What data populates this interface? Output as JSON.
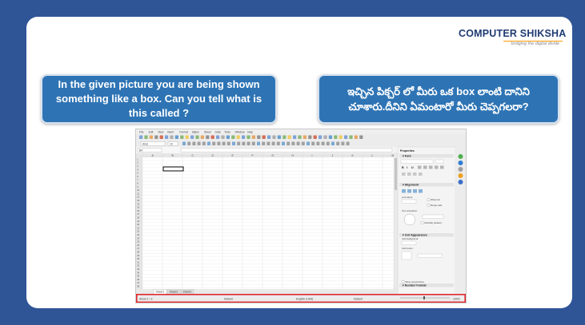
{
  "logo": {
    "brand": "COMPUTER SHIKSHA",
    "tagline": "bridging the digital divide"
  },
  "questions": {
    "english": "In the given picture you are being shown something like a box. Can you tell what is this called ?",
    "telugu": "ఇచ్చిన పిక్చర్ లో మీరు ఒక box లాంటి దానిని చూశారు.దీనిని ఏమంటారో మీరు చెప్పగలరా?"
  },
  "screenshot": {
    "menu": [
      "File",
      "Edit",
      "View",
      "Insert",
      "Format",
      "Styles",
      "Sheet",
      "Data",
      "Tools",
      "Window",
      "Help"
    ],
    "font_name": "Arial",
    "font_size": "10",
    "name_box": "B4",
    "columns": [
      "A",
      "B",
      "C",
      "D",
      "E",
      "F",
      "G",
      "H",
      "I",
      "J",
      "K",
      "L",
      "M"
    ],
    "sheet_tabs": [
      "Sheet1",
      "Sheet2",
      "Sheet3"
    ],
    "status": {
      "sheet": "Sheet 1 / 3",
      "style": "Default",
      "language": "English (USA)",
      "mode": "Default",
      "zoom": "100%"
    },
    "sidebar": {
      "title": "Properties",
      "sections": [
        "Font",
        "Alignment",
        "Cell Appearance",
        "Number Format"
      ],
      "labels": {
        "indent": "Left indent:",
        "wrap": "Wrap text",
        "merge": "Merge cells",
        "orientation": "Text orientation:",
        "degrees": "0 degrees",
        "vertical": "Vertically stacked",
        "cell_bg": "Cell background:",
        "cell_border": "Cell border:",
        "grid": "Show cell grid lines"
      }
    },
    "highlight_color": "#e0282e"
  }
}
